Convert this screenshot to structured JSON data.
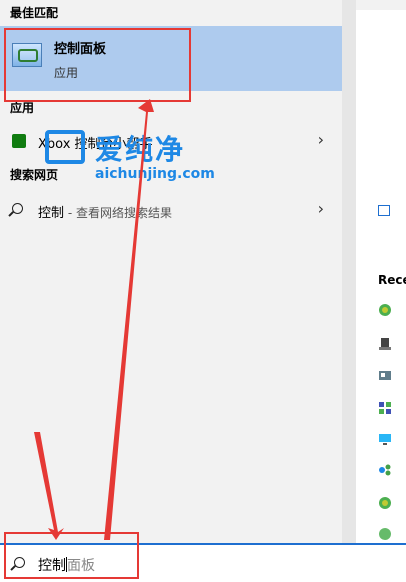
{
  "sections": {
    "best_match": "最佳匹配",
    "apps": "应用",
    "web": "搜索网页"
  },
  "best_match_item": {
    "title": "控制面板",
    "subtitle": "应用"
  },
  "apps": [
    {
      "label": "Xbox 控制台小帮手"
    }
  ],
  "web_result": {
    "query": "控制",
    "hint": " - 查看网络搜索结果"
  },
  "right_panel": {
    "recent_label": "Rece"
  },
  "search_bar": {
    "typed": "控制",
    "suggestion": "面板"
  },
  "watermark": {
    "cn": "爱纯净",
    "en": "aichunjing.com"
  },
  "colors": {
    "selection": "#aecbee",
    "accent": "#1e6fd0",
    "annotation": "#e53935",
    "watermark": "#1e88e5"
  }
}
